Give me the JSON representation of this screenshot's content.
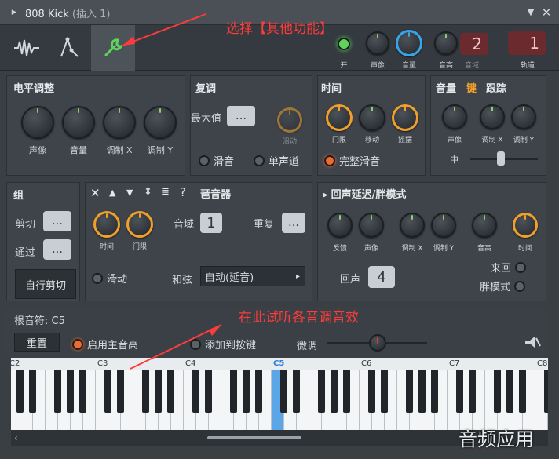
{
  "window": {
    "title": "808 Kick",
    "subtitle": "(插入 1)"
  },
  "annotations": {
    "top": "选择【其他功能】",
    "middle": "在此试听各音调音效",
    "watermark": "音频应用"
  },
  "top_controls": {
    "on_label": "开",
    "pan_label": "声像",
    "volume_label": "音量",
    "pitch_label": "音高",
    "range_label": "音域",
    "range_value": "2",
    "track_label": "轨道",
    "track_value": "1"
  },
  "level_panel": {
    "title": "电平调整",
    "knobs": [
      "声像",
      "音量",
      "调制 X",
      "调制 Y"
    ]
  },
  "polyphony_panel": {
    "title": "复调",
    "max_label": "最大值",
    "max_value": "…",
    "slide_small": "滑动",
    "slide_label": "滑音",
    "mono_label": "单声道"
  },
  "time_panel": {
    "title": "时间",
    "knobs": [
      "门限",
      "移动",
      "摇摆"
    ],
    "full_porta_label": "完整滑音"
  },
  "tracking_panel": {
    "tab_volume": "音量",
    "tab_key": "键",
    "tab_tracking": "跟踪",
    "knobs": [
      "声像",
      "调制 X",
      "调制 Y"
    ],
    "mid_label": "中"
  },
  "group_panel": {
    "title": "组",
    "cut_label": "剪切",
    "by_label": "通过",
    "cut_value": "…",
    "by_value": "…",
    "auto_cut_label": "自行剪切"
  },
  "arp_panel": {
    "title": "琶音器",
    "help": "?",
    "knobs": [
      "时间",
      "门限"
    ],
    "range_label": "音域",
    "range_value": "1",
    "repeat_label": "重复",
    "repeat_value": "…",
    "slide_label": "滑动",
    "chord_label": "和弦",
    "chord_value": "自动(延音)"
  },
  "echo_panel": {
    "title": "回声延迟/胖模式",
    "knobs": [
      "反馈",
      "声像",
      "调制 X",
      "调制 Y",
      "音高",
      "时间"
    ],
    "echo_label": "回声",
    "echo_value": "4",
    "pingpong_label": "来回",
    "fat_label": "胖模式"
  },
  "root_note": {
    "label": "根音符: C5",
    "reset_label": "重置",
    "main_pitch_label": "启用主音高",
    "add_key_label": "添加到按键",
    "fine_label": "微调"
  },
  "piano": {
    "octave_labels": [
      "C2",
      "C3",
      "C4",
      "C5",
      "C6",
      "C7",
      "C8"
    ],
    "highlight": "C5"
  },
  "colors": {
    "accent_orange": "#f0a02a",
    "accent_green": "#5fd35a",
    "accent_blue": "#3aa4e8",
    "annotation_red": "#ff3b3b"
  }
}
